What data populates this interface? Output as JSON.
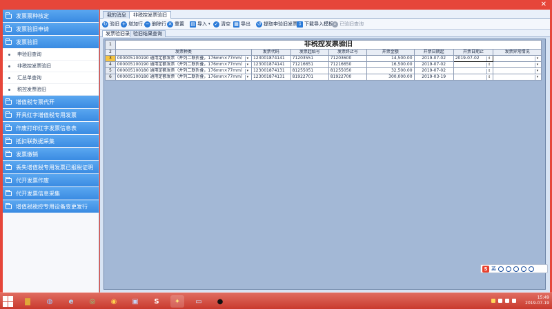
{
  "window": {
    "close_glyph": "✕"
  },
  "sidebar": {
    "items": [
      {
        "label": "发票票种核定"
      },
      {
        "label": "发票验旧申请"
      },
      {
        "label": "发票验旧"
      },
      {
        "label": "增值税专票代开"
      },
      {
        "label": "开具红字增值税专用发票"
      },
      {
        "label": "作废打印红字发票信息表"
      },
      {
        "label": "抵扣联数据采集"
      },
      {
        "label": "发票缴销"
      },
      {
        "label": "丢失增值税专用发票已报税证明"
      },
      {
        "label": "代开发票作废"
      },
      {
        "label": "代开发票信息采集"
      },
      {
        "label": "增值税税控专用设备变更发行"
      }
    ],
    "sub_items": [
      {
        "label": "申验旧查询"
      },
      {
        "label": "非税控发票验旧"
      },
      {
        "label": "汇总单查询"
      },
      {
        "label": "税控发票验旧"
      }
    ]
  },
  "tabs": [
    {
      "label": "我的消息"
    },
    {
      "label": "非税控发票验旧"
    }
  ],
  "toolbar": {
    "buttons": [
      {
        "label": "验旧",
        "icon": "refresh-icon",
        "color": "#2a7ad8"
      },
      {
        "label": "增加行",
        "icon": "plus-icon",
        "color": "#2a7ad8"
      },
      {
        "label": "删除行",
        "icon": "minus-icon",
        "color": "#2a7ad8"
      },
      {
        "label": "重置",
        "icon": "reset-icon",
        "color": "#2a7ad8"
      },
      {
        "label": "导入",
        "icon": "import-icon",
        "color": "#2a7ad8"
      },
      {
        "label": "清空",
        "icon": "check-icon",
        "color": "#2a7ad8"
      },
      {
        "label": "导出",
        "icon": "export-icon",
        "color": "#2a7ad8"
      },
      {
        "label": "提取申验旧发票",
        "icon": "fetch-icon",
        "color": "#2a7ad8"
      },
      {
        "label": "下载导入模板",
        "icon": "download-icon",
        "color": "#2a7ad8"
      },
      {
        "label": "已验旧查询",
        "icon": "search-icon",
        "color": "#9aa4b5"
      }
    ]
  },
  "subtabs": [
    {
      "label": "发票验旧录入"
    },
    {
      "label": "验旧结果查询"
    }
  ],
  "grid": {
    "title": "非税控发票验旧",
    "row_numbers": [
      "1",
      "2",
      "3",
      "4",
      "5",
      "6"
    ],
    "columns": [
      "发票种类",
      "发票代码",
      "发票起始号",
      "发票终止号",
      "开票金额",
      "开票日期起",
      "开票日期止",
      "发票异常情况"
    ],
    "rows": [
      {
        "kind": "000005100190 通用定额发票（并列二联折叠，176mm×77mm）",
        "code": "123001874141",
        "start": "71203551",
        "end": "71203600",
        "amount": "14,500.00",
        "date_from": "2019-07-02",
        "date_to": "2019-07-02",
        "status": ""
      },
      {
        "kind": "000005100190 通用定额发票（并列二联折叠，176mm×77mm）",
        "code": "123001874141",
        "start": "71216651",
        "end": "71216650",
        "amount": "16,500.00",
        "date_from": "2019-07-02",
        "date_to": "",
        "status": ""
      },
      {
        "kind": "000005100180 通用定额发票（并列二联折叠，176mm×77mm）",
        "code": "123001874131",
        "start": "81255051",
        "end": "81255050",
        "amount": "32,500.00",
        "date_from": "2019-07-02",
        "date_to": "",
        "status": ""
      },
      {
        "kind": "000005100180 通用定额发票（并列二联折叠，176mm×77mm）",
        "code": "123001874131",
        "start": "81922701",
        "end": "81922700",
        "amount": "300,000.00",
        "date_from": "2019-03-19",
        "date_to": "",
        "status": ""
      }
    ]
  },
  "ime": {
    "badge": "S",
    "text": "英"
  },
  "taskbar": {
    "apps": [
      {
        "name": "file-explorer-icon",
        "color": "#e0a838",
        "glyph": "▇"
      },
      {
        "name": "firefox-like-icon",
        "color": "#2a6fd8",
        "glyph": "◍"
      },
      {
        "name": "ie-icon",
        "color": "#3aa0e8",
        "glyph": "e"
      },
      {
        "name": "360-icon",
        "color": "#3db24a",
        "glyph": "◎"
      },
      {
        "name": "chrome-icon",
        "color": "#e8b52a",
        "glyph": "◉"
      },
      {
        "name": "tools-icon",
        "color": "#3457a8",
        "glyph": "▣"
      },
      {
        "name": "sogou-icon",
        "color": "#2c7be0",
        "glyph": "S"
      },
      {
        "name": "tax-app-icon",
        "color": "#c7362a",
        "glyph": "✦"
      },
      {
        "name": "window-icon",
        "color": "#6ca0d8",
        "glyph": "▭"
      },
      {
        "name": "record-icon",
        "color": "#111111",
        "glyph": "●"
      }
    ],
    "time": "15:49",
    "date": "2019-07-19"
  }
}
